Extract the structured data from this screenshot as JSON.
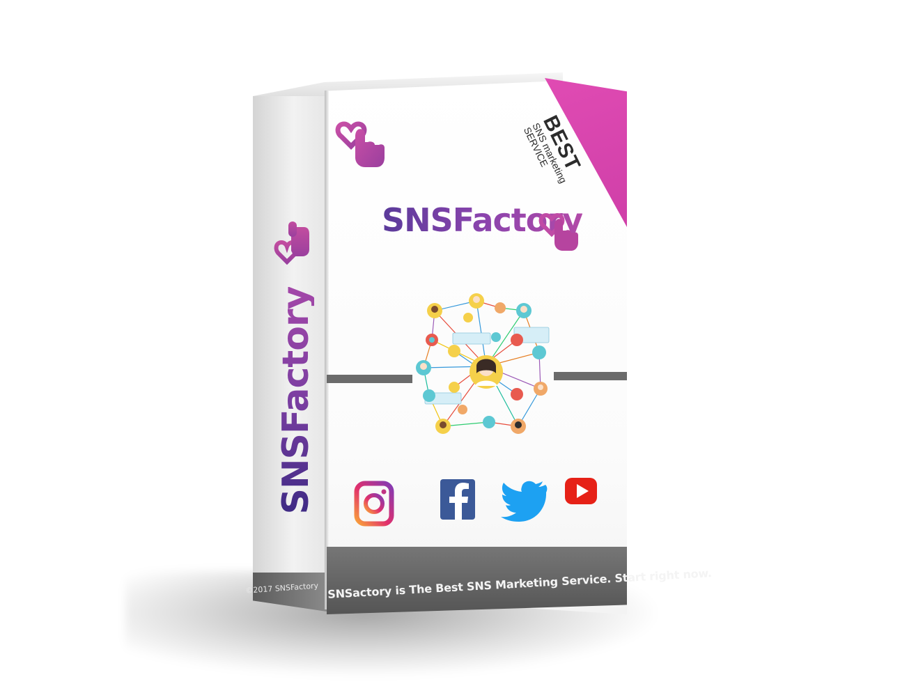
{
  "brand": {
    "name": "SNSFactory",
    "side_name": "SNSFactory"
  },
  "badge": {
    "line1": "BEST",
    "line2": "SNS marketing",
    "line3": "SERVICE"
  },
  "footer": {
    "tagline": "SNSactory is The Best SNS Marketing Service. Start right now.",
    "copyright": "©2017 SNSFactory"
  },
  "social_icons": [
    "instagram-icon",
    "facebook-icon",
    "twitter-icon",
    "youtube-icon"
  ],
  "colors": {
    "brand_purple": "#6a3fa0",
    "brand_pink": "#c253ad",
    "badge_pink": "#d946b0",
    "band_gray": "#666666",
    "instagram": "#c13584",
    "facebook": "#3b5998",
    "twitter": "#1da1f2",
    "youtube": "#e62117"
  }
}
